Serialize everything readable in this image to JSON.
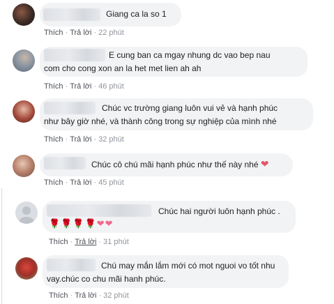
{
  "comments": [
    {
      "text": "Giang ca la so 1",
      "actions": {
        "like": "Thích",
        "reply": "Trả lời",
        "time": "22 phút"
      }
    },
    {
      "text": "E cung ban ca mgay nhung dc vao bep nau\ncom cho cong xon an la het met lien ah ah",
      "actions": {
        "like": "Thích",
        "reply": "Trả lời",
        "time": "46 phút"
      }
    },
    {
      "text": "Chúc vc trường giang luôn vui vẻ và hạnh phúc\nnhư bây giờ nhé, và thành công trong sự nghiệp của mình nhé",
      "actions": {
        "like": "Thích",
        "reply": "Trả lời",
        "time": "32 phút"
      }
    },
    {
      "text": "Chúc cô chú mãi hạnh phúc như thế này nhé",
      "emoji": "heart",
      "actions": {
        "like": "Thích",
        "reply": "Trả lời",
        "time": "45 phút"
      }
    },
    {
      "text": "Chúc hai người luôn hạnh phúc .",
      "emoji_row": [
        "rose",
        "rose",
        "rose",
        "rose",
        "heart",
        "heart"
      ],
      "actions": {
        "like": "Thích",
        "reply": "Trả lời",
        "time": "31 phút"
      }
    },
    {
      "text": "Chú may mắn lắm mới có mot nguoi vo tốt nhu\nvay.chúc co chu mãi hanh phúc.",
      "actions": {
        "like": "Thích",
        "reply": "Trả lời",
        "time": "32 phút"
      }
    }
  ],
  "icons": {
    "rose": "🌹",
    "heart": "❤"
  },
  "colors": {
    "bubble": "#f2f3f5",
    "action_text": "#4b4f56",
    "time_text": "#90949c",
    "heart": "#e05a6c"
  }
}
